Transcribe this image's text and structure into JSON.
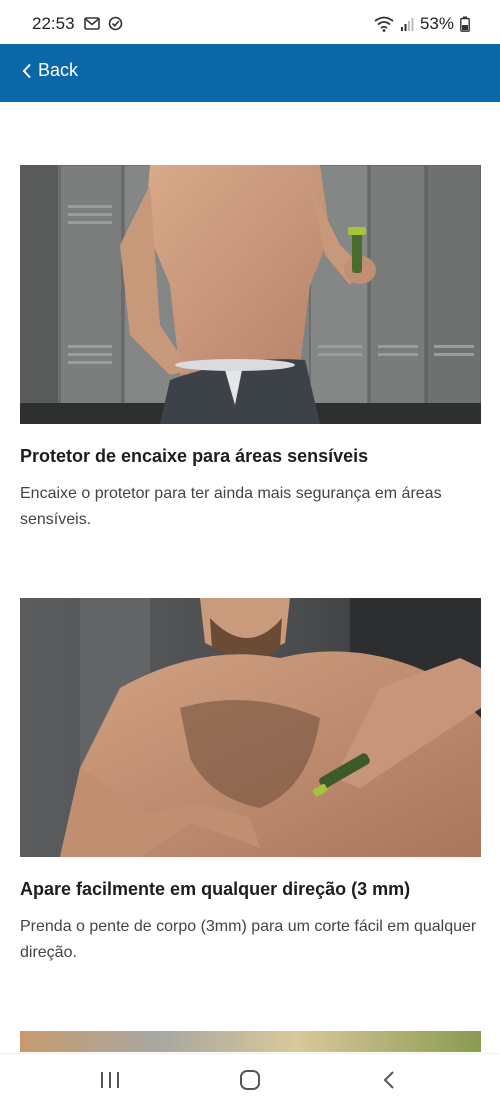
{
  "status_bar": {
    "time": "22:53",
    "battery": "53%"
  },
  "header": {
    "back_label": "Back",
    "background": "#0b67a8"
  },
  "features": [
    {
      "title": "Protetor de encaixe para áreas sensíveis",
      "description": "Encaixe o protetor para ter ainda mais segurança em áreas sensíveis."
    },
    {
      "title": "Apare facilmente em qualquer direção (3 mm)",
      "description": "Prenda o pente de corpo (3mm) para um corte fácil em qualquer direção."
    }
  ]
}
